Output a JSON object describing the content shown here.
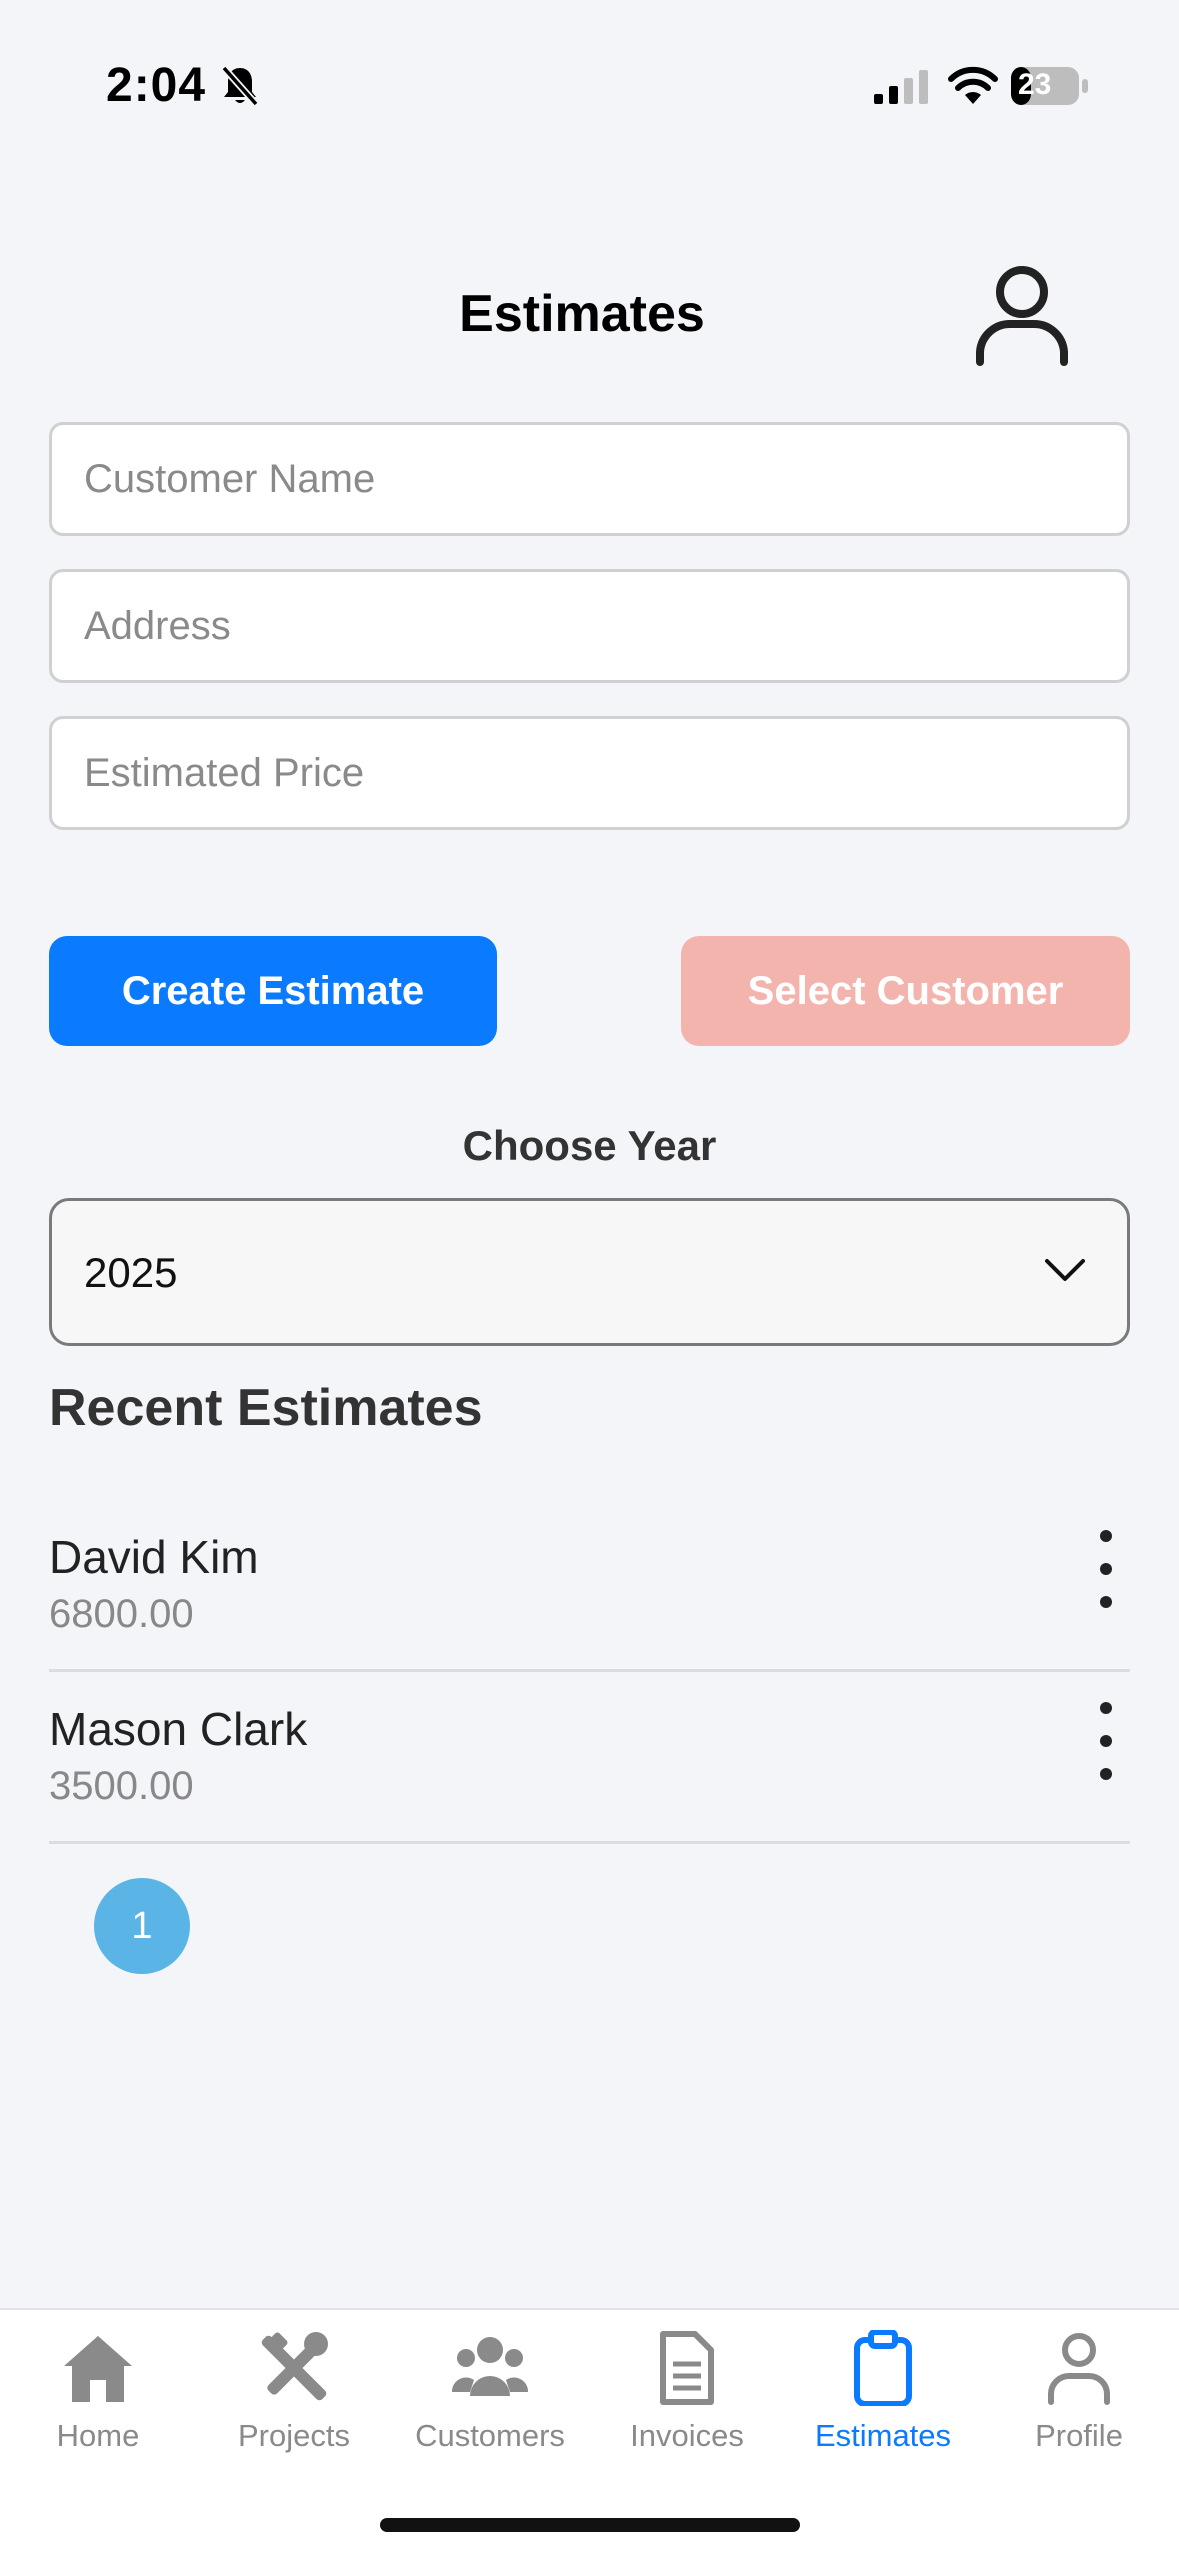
{
  "status_bar": {
    "time": "2:04",
    "battery": "23",
    "icons": [
      "bell-slash-icon",
      "cellular-signal-icon",
      "wifi-icon",
      "battery-icon"
    ]
  },
  "header": {
    "title": "Estimates",
    "avatar_icon": "user-outline-icon"
  },
  "form": {
    "customer_name_placeholder": "Customer Name",
    "customer_name_value": "",
    "address_placeholder": "Address",
    "address_value": "",
    "price_placeholder": "Estimated Price",
    "price_value": ""
  },
  "actions": {
    "create_label": "Create Estimate",
    "select_label": "Select Customer"
  },
  "year_picker": {
    "label": "Choose Year",
    "selected": "2025"
  },
  "recent": {
    "title": "Recent Estimates",
    "items": [
      {
        "name": "David Kim",
        "amount": "6800.00"
      },
      {
        "name": "Mason Clark",
        "amount": "3500.00"
      }
    ]
  },
  "pagination": {
    "current": "1"
  },
  "tabs": [
    {
      "label": "Home",
      "icon": "home-icon",
      "active": false
    },
    {
      "label": "Projects",
      "icon": "tools-icon",
      "active": false
    },
    {
      "label": "Customers",
      "icon": "users-icon",
      "active": false
    },
    {
      "label": "Invoices",
      "icon": "document-icon",
      "active": false
    },
    {
      "label": "Estimates",
      "icon": "clipboard-icon",
      "active": true
    },
    {
      "label": "Profile",
      "icon": "person-icon",
      "active": false
    }
  ],
  "colors": {
    "primary": "#0a7aff",
    "select_button": "#f4b4ae",
    "page_bubble": "#5ab4e5",
    "background": "#f3f5f9",
    "inactive_tab": "#8a8a8a"
  }
}
